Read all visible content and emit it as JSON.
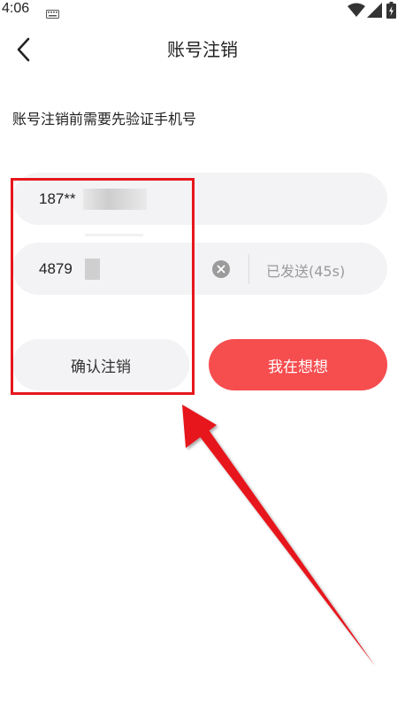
{
  "status_bar": {
    "time": "4:06",
    "icons": [
      "keyboard-icon",
      "wifi-icon",
      "signal-icon",
      "battery-charging-icon"
    ]
  },
  "header": {
    "title": "账号注销",
    "back_icon": "chevron-left-icon"
  },
  "instruction": "账号注销前需要先验证手机号",
  "form": {
    "phone_value": "187**",
    "code_value": "4879",
    "clear_icon": "clear-circle-icon",
    "resend_label": "已发送(45s)"
  },
  "buttons": {
    "confirm_label": "确认注销",
    "think_label": "我在想想"
  },
  "colors": {
    "primary": "#f64d4f",
    "field_bg": "#f3f3f5",
    "highlight": "#e6171c"
  }
}
